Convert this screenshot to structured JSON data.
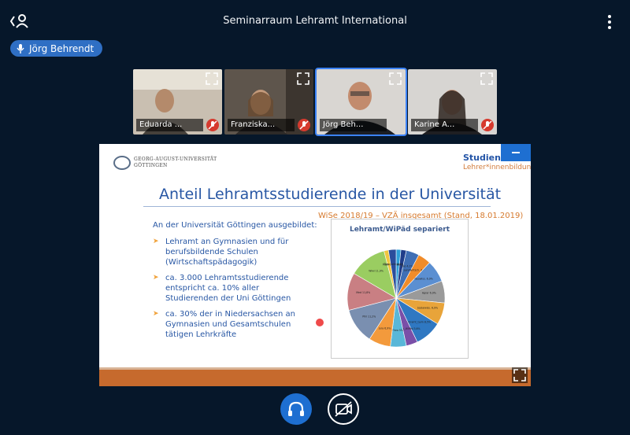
{
  "header": {
    "title": "Seminarraum Lehramt International",
    "icons": {
      "user_list_toggle": "user-list-icon",
      "options": "more-vertical-icon"
    }
  },
  "talking_indicator": {
    "name": "Jörg Behrendt",
    "icon": "microphone-icon"
  },
  "video_tiles": [
    {
      "name": "Eduarda ...",
      "muted": true,
      "talking": false
    },
    {
      "name": "Franziska...",
      "muted": true,
      "talking": false
    },
    {
      "name": "Jörg Beh...",
      "muted": false,
      "talking": true
    },
    {
      "name": "Karine A...",
      "muted": true,
      "talking": false
    }
  ],
  "slide": {
    "university_line1": "GEORG-AUGUST-UNIVERSITÄT",
    "university_line2": "GÖTTINGEN",
    "department_line1": "Studiendeka",
    "department_line2": "Lehrer*innenbildung",
    "title": "Anteil Lehramtsstudierende in der Universität",
    "subhead": "WiSe 2018/19 – VZÄ insgesamt (Stand, 18.01.2019)",
    "intro": "An der Universität Göttingen ausgebildet:",
    "bullets": [
      "Lehramt an Gymnasien und für berufsbildende Schulen (Wirtschaftspädagogik)",
      "ca. 3.000 Lehramtsstudierende entspricht ca. 10% aller Studierenden der Uni Göttingen",
      "ca. 30% der in Niedersachsen an Gymnasien und Gesamtschulen tätigen Lehrkräfte"
    ]
  },
  "chart_data": {
    "type": "pie",
    "title": "Lehramt/WiPäd separiert",
    "slices": [
      {
        "label": "Chemie",
        "value": 1.5,
        "color": "#2e9fd8"
      },
      {
        "label": "Physik",
        "value": 1.7,
        "color": "#1f3d8a"
      },
      {
        "label": "Bio",
        "value": 4.1,
        "color": "#3f6fb5"
      },
      {
        "label": "Landwirtsch.",
        "value": 4.1,
        "color": "#f08c2a"
      },
      {
        "label": "Geowiss.",
        "value": 6.9,
        "color": "#5b8fd1"
      },
      {
        "label": "Agrar",
        "value": 6.9,
        "color": "#9a9a9a"
      },
      {
        "label": "Sozialwiss.",
        "value": 6.9,
        "color": "#e8a43a"
      },
      {
        "label": "Lehramt_Gym",
        "value": 8.5,
        "color": "#2f78c2"
      },
      {
        "label": "Lehramt_WiPäd",
        "value": 3.6,
        "color": "#7a4fa8"
      },
      {
        "label": "Theo",
        "value": 5.0,
        "color": "#59b7d8"
      },
      {
        "label": "Jura",
        "value": 6.9,
        "color": "#f39a3c"
      },
      {
        "label": "Phil",
        "value": 11.2,
        "color": "#7a8fb0"
      },
      {
        "label": "Med",
        "value": 11.8,
        "color": "#c97f83"
      },
      {
        "label": "Wiwi",
        "value": 11.9,
        "color": "#9acd61"
      },
      {
        "label": "Math",
        "value": 1.4,
        "color": "#f0c640"
      },
      {
        "label": "Theo Lehr",
        "value": 2.4,
        "color": "#2b4d9c"
      }
    ]
  },
  "controls": {
    "audio_icon": "headphones-icon",
    "video_icon": "video-off-icon"
  }
}
